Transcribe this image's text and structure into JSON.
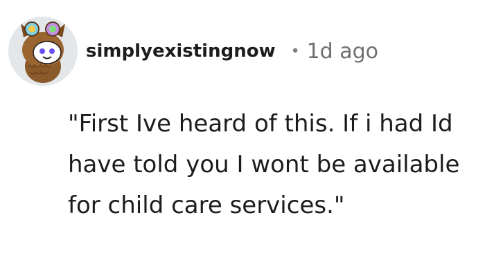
{
  "comment": {
    "username": "simplyexistingnow",
    "separator": "•",
    "timestamp": "1d ago",
    "avatar_icon": "snoo-owl-avatar-icon",
    "body": "\"First Ive heard of this. If i had Id have told you I wont be available for child care services.\""
  }
}
